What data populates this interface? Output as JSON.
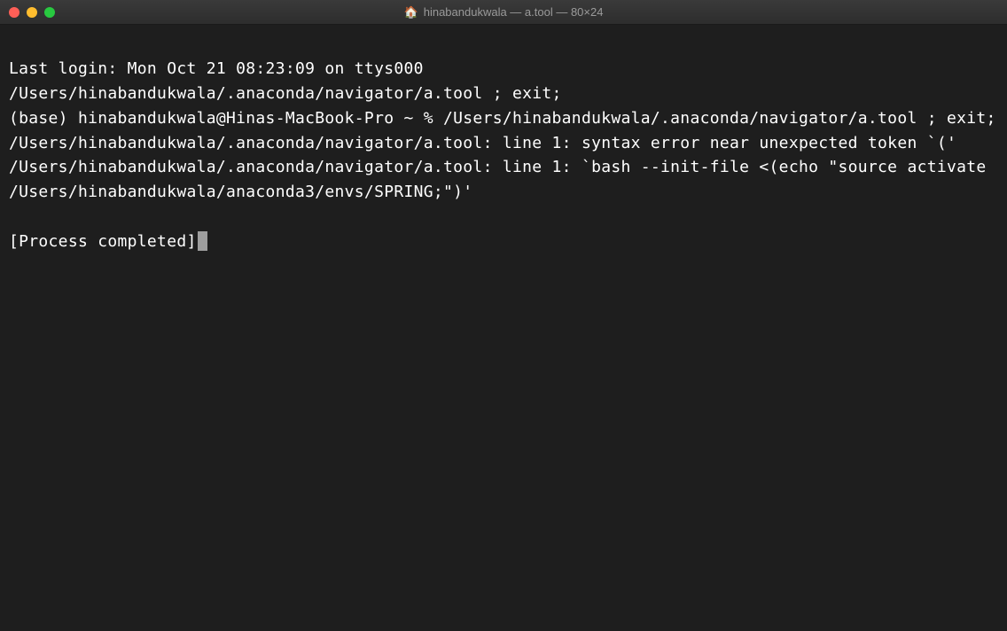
{
  "window": {
    "title": "hinabandukwala — a.tool — 80×24",
    "home_icon": "🏠"
  },
  "terminal": {
    "lines": {
      "line1": "Last login: Mon Oct 21 08:23:09 on ttys000",
      "line2": "/Users/hinabandukwala/.anaconda/navigator/a.tool ; exit;",
      "line3": "(base) hinabandukwala@Hinas-MacBook-Pro ~ % /Users/hinabandukwala/.anaconda/navigator/a.tool ; exit;",
      "line4": "/Users/hinabandukwala/.anaconda/navigator/a.tool: line 1: syntax error near unexpected token `('",
      "line5": "/Users/hinabandukwala/.anaconda/navigator/a.tool: line 1: `bash --init-file <(echo \"source activate /Users/hinabandukwala/anaconda3/envs/SPRING;\")'",
      "line6": "[Process completed]"
    }
  }
}
